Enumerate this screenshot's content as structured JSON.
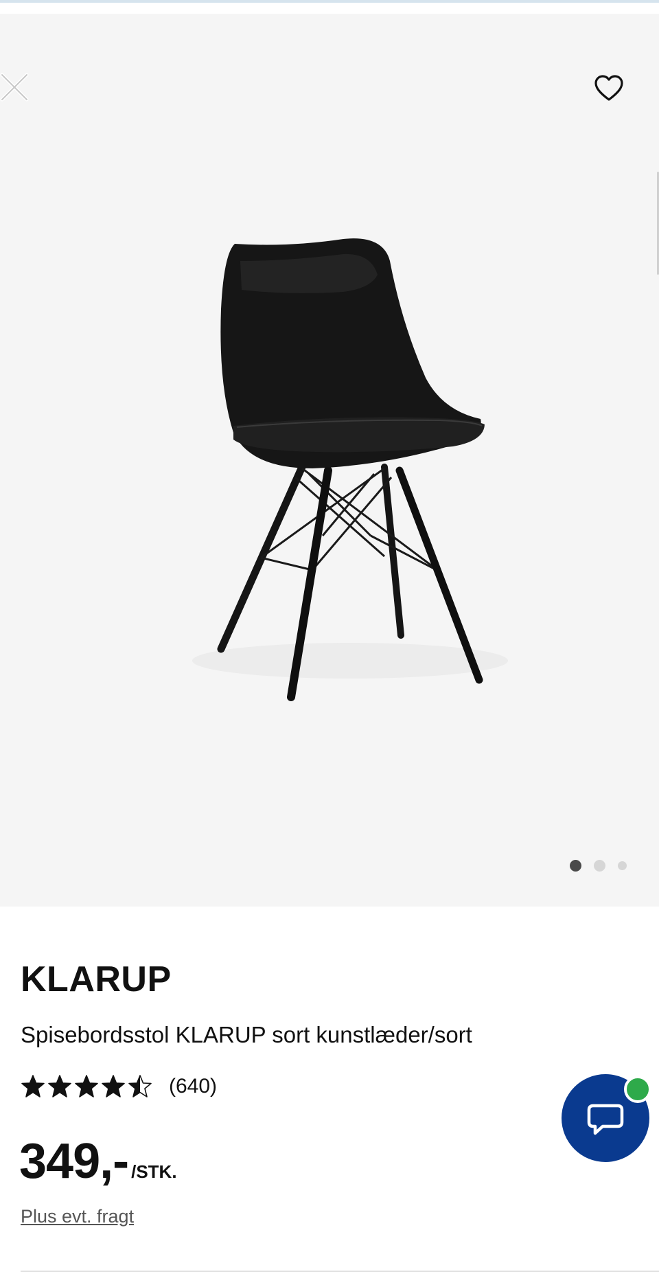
{
  "product": {
    "brand": "KLARUP",
    "description": "Spisebordsstol KLARUP sort kunstlæder/sort",
    "rating_value": 4.5,
    "rating_max": 5,
    "review_count": "(640)",
    "price": "349,-",
    "price_unit": "/STK.",
    "freight_link": "Plus evt. fragt"
  },
  "gallery": {
    "image_count": 3,
    "active_index": 0
  },
  "icons": {
    "close": "close-icon",
    "favorite": "heart-icon",
    "chat": "chat-bubble-icon",
    "star": "star-icon"
  },
  "colors": {
    "chat_button": "#0a3a8f",
    "chat_status": "#2eaa4a",
    "gallery_bg": "#f5f5f5",
    "text": "#111111"
  }
}
